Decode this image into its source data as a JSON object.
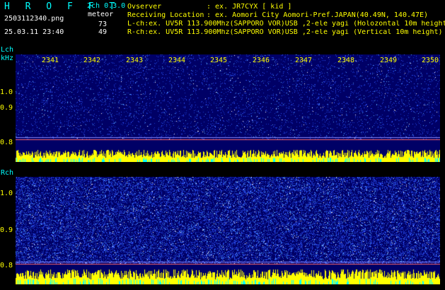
{
  "header": {
    "logo": "H R O F F T",
    "version": "2ch 0.3.0",
    "filename": "2503112340.png",
    "meteor_label": "meteor",
    "datetime": "25.03.11 23:40",
    "l_count": "73",
    "r_count": "49",
    "observer_label": "Ovserver",
    "observer_value": ": ex. JR7CYX [ kid ]",
    "location_label": "Receiving Location",
    "location_value": ": ex. Aomori City Aomori-Pref.JAPAN(40.49N, 140.47E)",
    "lch_info": "L-ch:ex. UV5R 113.900Mhz(SAPPORO VOR)USB ,2-ele yagi (Holozontal 10m height)",
    "rch_info": "R-ch:ex. UV5R 113.900Mhz(SAPPORO VOR)USB ,2-ele yagi (Vertical 10m height)"
  },
  "lch": {
    "label": "Lch",
    "unit": "kHz",
    "yticks": [
      "1.0",
      "0.9",
      "0.8"
    ],
    "xticks": [
      "2341",
      "2342",
      "2343",
      "2344",
      "2345",
      "2346",
      "2347",
      "2348",
      "2349",
      "2350"
    ]
  },
  "rch": {
    "label": "Rch",
    "yticks": [
      "1.0",
      "0.9",
      "0.8"
    ]
  },
  "colors": {
    "background": "#000066",
    "noise": "#3355ff",
    "signal": "#ffff00",
    "signal_alt": "#00ffff",
    "text_cyan": "#00ffff",
    "text_yellow": "#ffff00"
  }
}
